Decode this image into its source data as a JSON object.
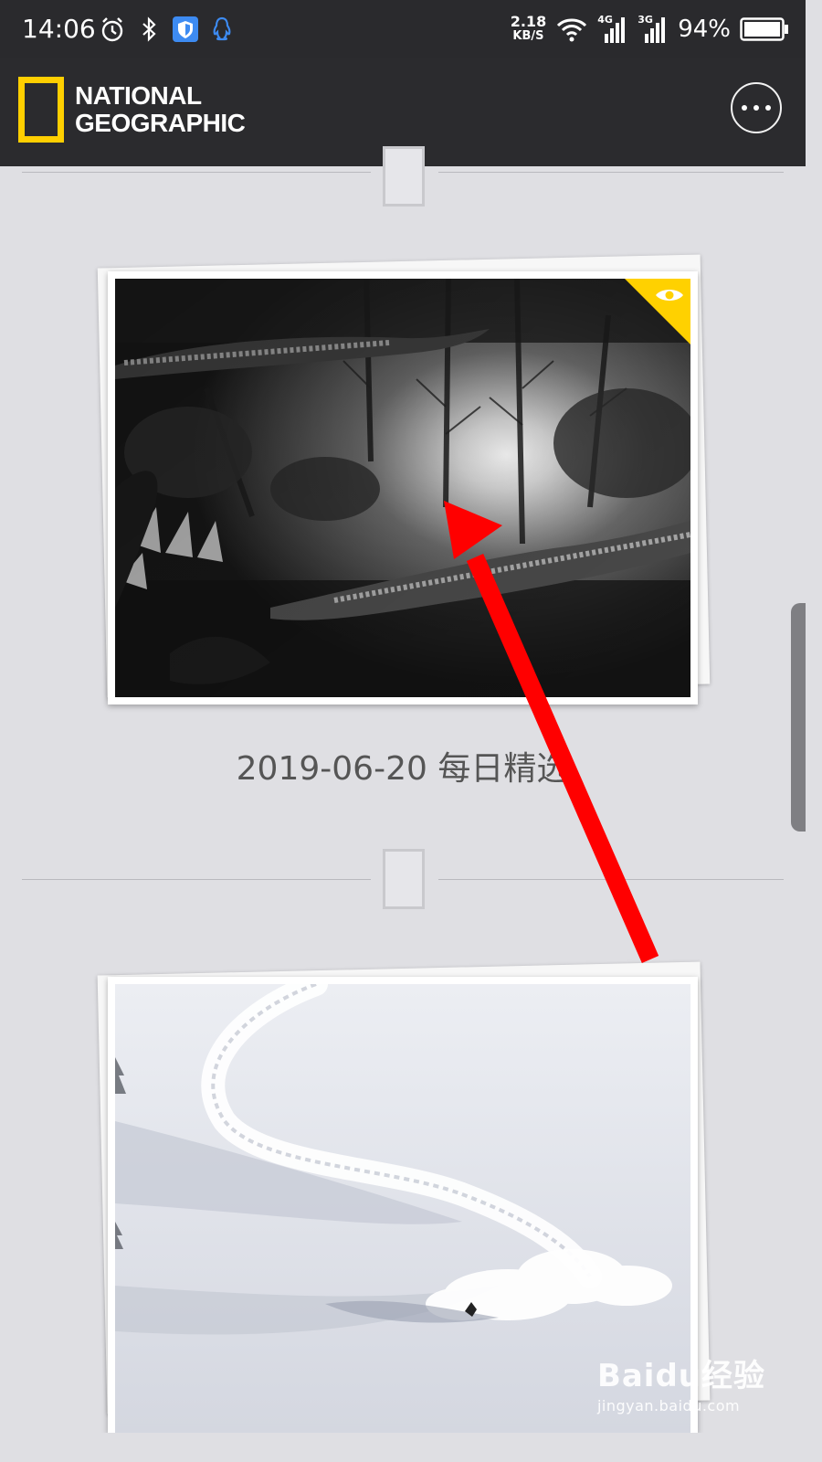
{
  "status_bar": {
    "time": "14:06",
    "net_speed_value": "2.18",
    "net_speed_unit": "KB/S",
    "signal_1_label": "4G",
    "signal_2_label": "3G",
    "battery": "94%"
  },
  "app": {
    "logo_line1": "NATIONAL",
    "logo_line2": "GEOGRAPHIC",
    "logo_color": "#ffcf00"
  },
  "feed": {
    "items": [
      {
        "caption": "2019-06-20 每日精选",
        "photo": "black-and-white crocodiles in forest reflection",
        "viewed_badge": "eye-icon"
      },
      {
        "caption": "",
        "photo": "skier carving turn in fresh snow"
      }
    ]
  },
  "watermark": {
    "brand": "Baidu经验",
    "url": "jingyan.baidu.com"
  },
  "colors": {
    "header_bg": "#2b2b2e",
    "page_bg": "#dfdfe3",
    "badge_yellow": "#ffd100",
    "annotation_red": "#ff0000"
  }
}
